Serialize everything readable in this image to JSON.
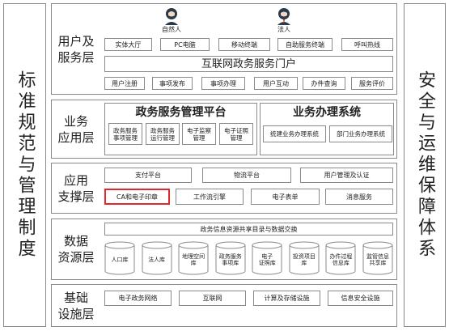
{
  "left_panel": {
    "label": "标准规范与管理制度"
  },
  "right_panel": {
    "label": "安全与运维保障体系"
  },
  "user_layer": {
    "name": "用户及\n服务层",
    "users": [
      "自然人",
      "法人"
    ],
    "channels": [
      "实体大厅",
      "PC电脑",
      "移动终端",
      "自助服务终端",
      "呼叫热线"
    ],
    "portal": "互联网政务服务门户",
    "services": [
      "用户注册",
      "事项发布",
      "事项办理",
      "用户互动",
      "办件查询",
      "服务评价"
    ]
  },
  "business_layer": {
    "name": "业务\n应用层",
    "platform": {
      "title": "政务服务管理平台",
      "items": [
        "政务服务\n事项管理",
        "政务服务\n运行管理",
        "电子监察\n管理",
        "电子证照\n管理"
      ]
    },
    "system": {
      "title": "业务办理系统",
      "items": [
        "统建业务办理系统",
        "部门业务办理系统"
      ]
    }
  },
  "support_layer": {
    "name": "应用\n支撑层",
    "row1": [
      "支付平台",
      "物流平台",
      "用户管理及认证"
    ],
    "row2": [
      "CA和电子印章",
      "工作流引擎",
      "电子表单",
      "消息服务"
    ],
    "highlighted": "CA和电子印章"
  },
  "data_layer": {
    "name": "数据\n资源层",
    "exchange": "政务信息资源共享目录与数据交换",
    "databases": [
      "人口库",
      "法人库",
      "地理空间\n库",
      "政务服务\n事项库",
      "电子\n证照库",
      "投资项目\n库",
      "办件过程\n信息库",
      "监管信息\n共享库"
    ]
  },
  "infra_layer": {
    "name": "基础\n设施层",
    "items": [
      "电子政务网络",
      "互联网",
      "计算及存储设施",
      "信息安全设施"
    ]
  },
  "colors": {
    "border": "#8a8a8a",
    "highlight": "#e0282d",
    "icon": "#2b3a4a"
  }
}
